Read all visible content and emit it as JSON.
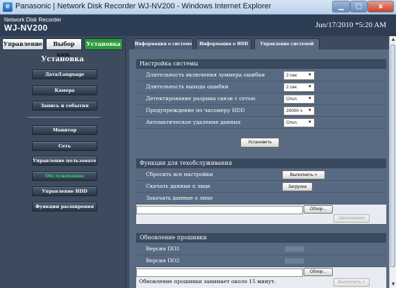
{
  "window": {
    "title": "Panasonic | Network Disk Recorder WJ-NV200 - Windows Internet Explorer",
    "minimize_glyph": "▁",
    "maximize_glyph": "□",
    "close_glyph": "x"
  },
  "app": {
    "subtitle": "Network Disk Recorder",
    "model": "WJ-NV200",
    "datetime": "Jun/17/2010  *5:20 AM"
  },
  "left_tabs": [
    {
      "label": "Управление"
    },
    {
      "label": "Выбор кам."
    },
    {
      "label": "Установка",
      "active": true
    }
  ],
  "left_panel": {
    "title": "Установка",
    "menu": [
      {
        "label": "Дата/Language"
      },
      {
        "label": "Камера"
      },
      {
        "label": "Запись и события"
      },
      {
        "label": "Монитор"
      },
      {
        "label": "Сеть"
      },
      {
        "label": "Управление пользователем"
      },
      {
        "label": "Обслуживание",
        "active": true
      },
      {
        "label": "Управление HDD"
      },
      {
        "label": "Функции расширения"
      }
    ]
  },
  "tabs": [
    {
      "label": "Информация о системе"
    },
    {
      "label": "Информация о HDD"
    },
    {
      "label": "Управление системой",
      "active": true
    }
  ],
  "system_settings": {
    "header": "Настройка системы",
    "rows": [
      {
        "label": "Длительность включения зуммера ошибки",
        "value": "2 сек"
      },
      {
        "label": "Длительность выхода ошибки",
        "value": "2 сек"
      },
      {
        "label": "Детектирование разрыва связи с сетью",
        "value": "Откл."
      },
      {
        "label": "Предупреждение по часомеру HDD",
        "value": "20000 ч"
      },
      {
        "label": "Автоматическое удаление данных",
        "value": "Откл."
      }
    ],
    "set_button": "Установить"
  },
  "maintenance": {
    "header": "Функции для техобслуживания",
    "reset_label": "Сбросить все настройки",
    "reset_button": "Выполнить >",
    "download_label": "Скачать данные о лице",
    "download_button": "Загрузка",
    "upload_label": "Закачать данные о лице",
    "browse_button": "Обзор...",
    "upload_button": "Закачивание"
  },
  "firmware": {
    "header": "Обновление прошивки",
    "version1_label": "Версия ПО1",
    "version2_label": "Версия ПО2",
    "browse_button": "Обзор...",
    "note": "Обновление прошивки занимает около 15 минут.",
    "execute_button": "Выполнить >"
  },
  "colors": {
    "active_tab": "#2a9a3a",
    "active_menu_text": "#32d35a",
    "header_bg": "#2d3d53"
  }
}
